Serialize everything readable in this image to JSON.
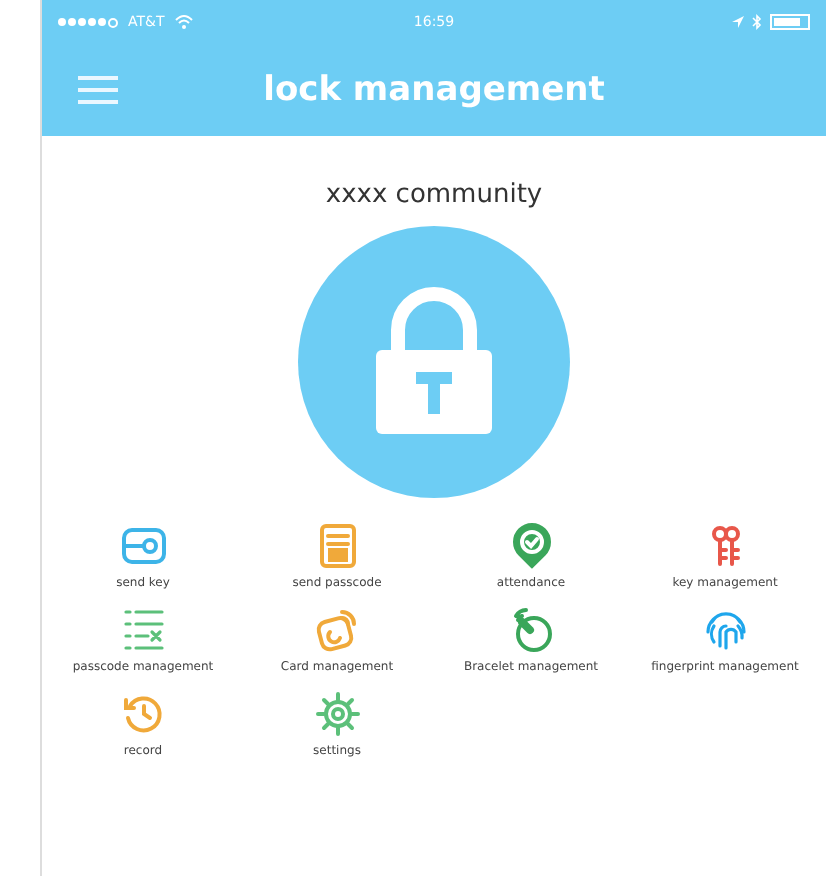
{
  "status_bar": {
    "carrier": "AT&T",
    "time": "16:59"
  },
  "nav_bar": {
    "title": "lock management"
  },
  "community": "xxxx community",
  "functions": [
    {
      "label": "send key",
      "kind": "key-card",
      "color": "#3db4e8"
    },
    {
      "label": "send passcode",
      "kind": "keypad",
      "color": "#f0a93a"
    },
    {
      "label": "attendance",
      "kind": "pin-check",
      "color": "#3aa65a"
    },
    {
      "label": "key management",
      "kind": "keys",
      "color": "#e8574a"
    },
    {
      "label": "passcode management",
      "kind": "list",
      "color": "#5cc07a"
    },
    {
      "label": "Card management",
      "kind": "card",
      "color": "#f0a93a"
    },
    {
      "label": "Bracelet management",
      "kind": "bracelet",
      "color": "#3aa65a"
    },
    {
      "label": "fingerprint management",
      "kind": "fingerprint",
      "color": "#1ea6ec"
    },
    {
      "label": "record",
      "kind": "history",
      "color": "#f0a93a"
    },
    {
      "label": "settings",
      "kind": "gear",
      "color": "#5cc07a"
    }
  ]
}
